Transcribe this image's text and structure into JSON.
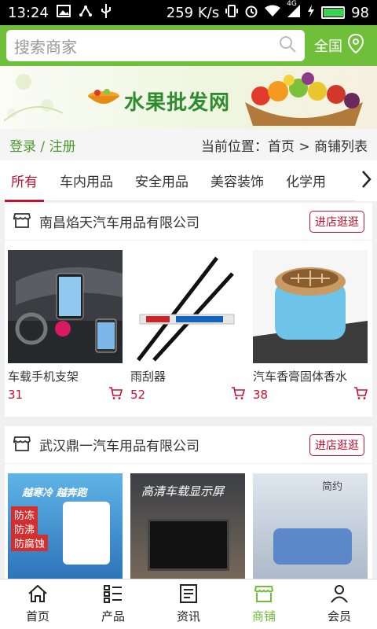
{
  "status": {
    "time": "13:24",
    "network": "259 K/s",
    "signal_label": "4G",
    "battery": "98",
    "battery_level": 0.98
  },
  "search": {
    "placeholder": "搜索商家",
    "region": "全国"
  },
  "banner": {
    "title": "水果批发网"
  },
  "crumb": {
    "login": "登录 / 注册",
    "location": "当前位置：首页 > 商铺列表"
  },
  "tabs": [
    {
      "label": "所有",
      "active": true
    },
    {
      "label": "车内用品"
    },
    {
      "label": "安全用品"
    },
    {
      "label": "美容装饰"
    },
    {
      "label": "化学用"
    }
  ],
  "stores": [
    {
      "name": "南昌焰天汽车用品有限公司",
      "visit_label": "进店逛逛",
      "products": [
        {
          "name": "车载手机支架",
          "price": "31"
        },
        {
          "name": "雨刮器",
          "price": "52"
        },
        {
          "name": "汽车香膏固体香水",
          "price": "38"
        }
      ]
    },
    {
      "name": "武汉鼎一汽车用品有限公司",
      "visit_label": "进店逛逛",
      "products": [
        {
          "name": "",
          "price": "",
          "overlay": [
            "越寒冷 越奔跑",
            "防冻",
            "防沸",
            "防腐蚀"
          ]
        },
        {
          "name": "",
          "price": "",
          "overlay": [
            "高清车载显示屏"
          ]
        },
        {
          "name": "",
          "price": "",
          "overlay": [
            "简约"
          ]
        }
      ]
    }
  ],
  "nav": [
    {
      "label": "首页",
      "icon": "home-icon"
    },
    {
      "label": "产品",
      "icon": "list-icon"
    },
    {
      "label": "资讯",
      "icon": "news-icon"
    },
    {
      "label": "商铺",
      "icon": "store-icon",
      "active": true
    },
    {
      "label": "会员",
      "icon": "user-icon"
    }
  ],
  "colors": {
    "brand_green": "#6fbf3a",
    "accent_red": "#c8102e"
  }
}
